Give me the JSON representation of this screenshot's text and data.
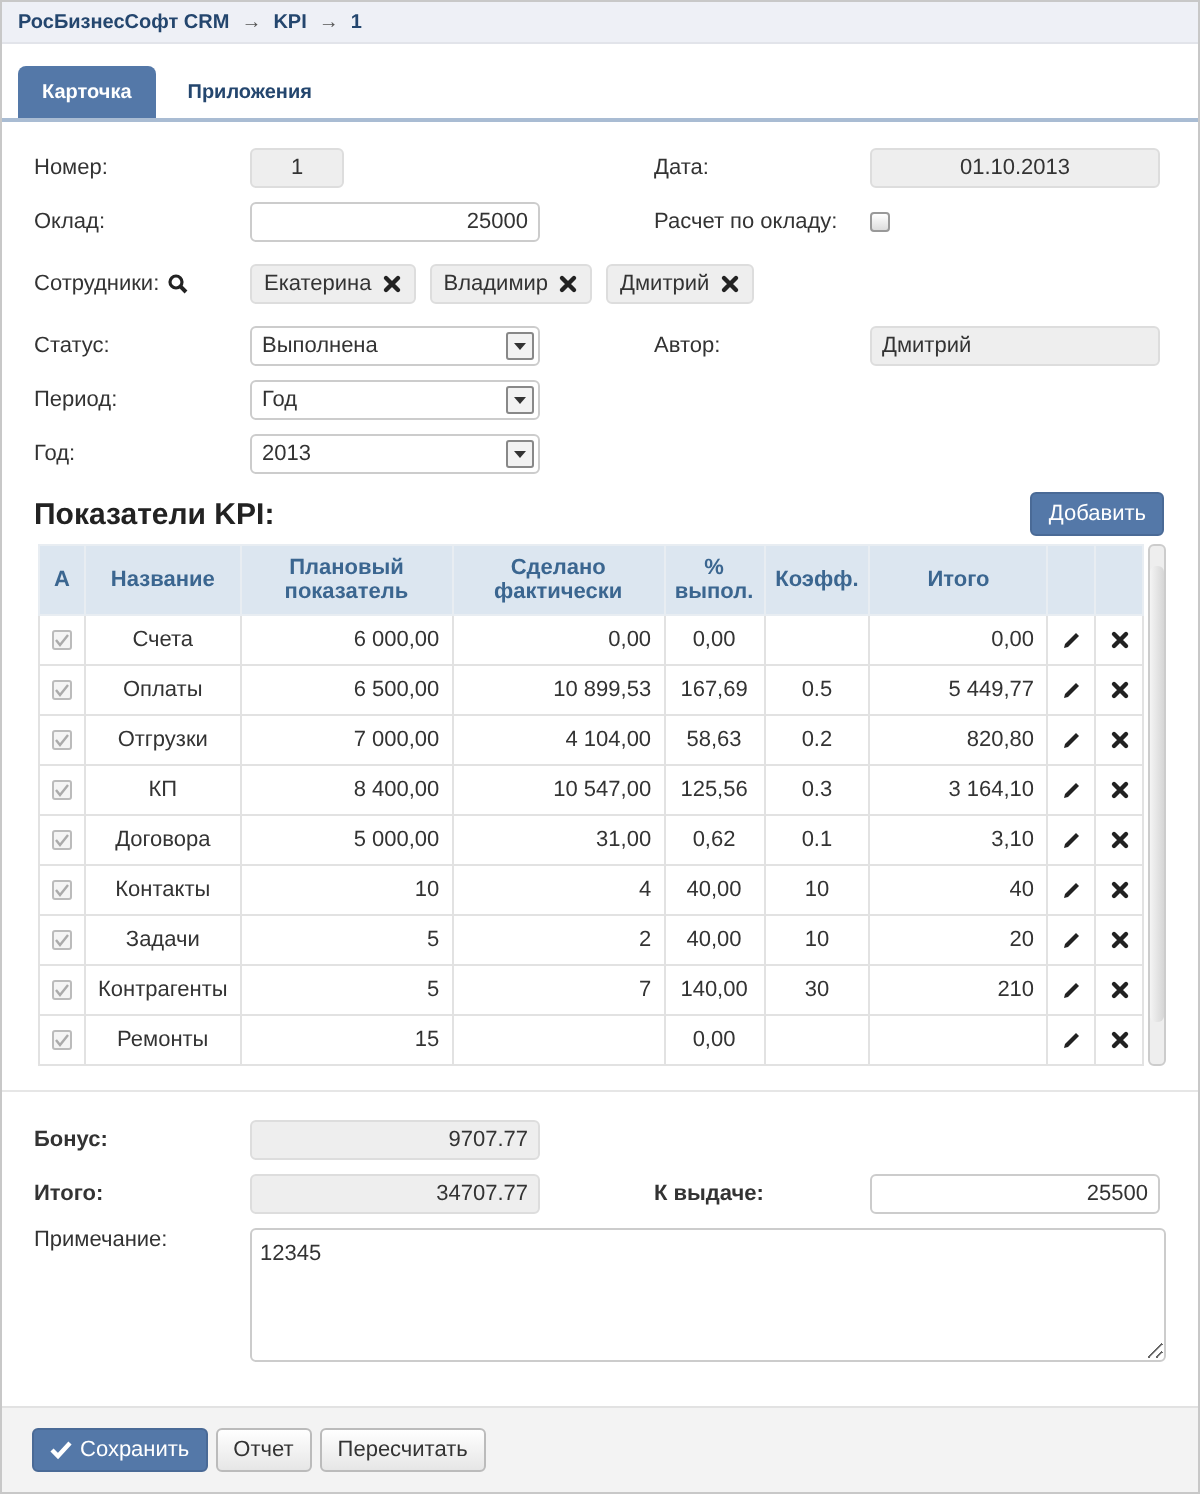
{
  "breadcrumb": {
    "items": [
      "РосБизнесСофт CRM",
      "KPI",
      "1"
    ],
    "separator": "→"
  },
  "tabs": [
    {
      "label": "Карточка",
      "selected": true
    },
    {
      "label": "Приложения",
      "selected": false
    }
  ],
  "form_rows": [
    {
      "left": {
        "label": "Номер:",
        "kind": "readonly_number",
        "value": "1"
      },
      "right": {
        "label": "Дата:",
        "kind": "readonly_date",
        "value": "01.10.2013"
      }
    },
    {
      "left": {
        "label": "Оклад:",
        "kind": "input",
        "value": "25000"
      },
      "right": {
        "label": "Расчет по окладу:",
        "kind": "checkbox",
        "checked": false
      }
    },
    {
      "left": {
        "label": "Сотрудники:",
        "kind": "tags",
        "tags": [
          "Екатерина",
          "Владимир",
          "Дмитрий"
        ]
      }
    },
    {
      "left": {
        "label": "Статус:",
        "kind": "select",
        "value": "Выполнена"
      },
      "right": {
        "label": "Автор:",
        "kind": "readonly_text",
        "value": "Дмитрий"
      }
    },
    {
      "left": {
        "label": "Период:",
        "kind": "select",
        "value": "Год"
      }
    },
    {
      "left": {
        "label": "Год:",
        "kind": "select",
        "value": "2013"
      }
    }
  ],
  "kpi": {
    "title": "Показатели KPI:",
    "add_button": "Добавить",
    "columns": [
      "A",
      "Название",
      "Плановый показатель",
      "Сделано фактически",
      "% выпол.",
      "Коэфф.",
      "Итого"
    ],
    "rows": [
      {
        "checked": true,
        "name": "Счета",
        "plan": "6 000,00",
        "done": "0,00",
        "percent": "0,00",
        "coef": "",
        "total": "0,00"
      },
      {
        "checked": true,
        "name": "Оплаты",
        "plan": "6 500,00",
        "done": "10 899,53",
        "percent": "167,69",
        "coef": "0.5",
        "total": "5 449,77"
      },
      {
        "checked": true,
        "name": "Отгрузки",
        "plan": "7 000,00",
        "done": "4 104,00",
        "percent": "58,63",
        "coef": "0.2",
        "total": "820,80"
      },
      {
        "checked": true,
        "name": "КП",
        "plan": "8 400,00",
        "done": "10 547,00",
        "percent": "125,56",
        "coef": "0.3",
        "total": "3 164,10"
      },
      {
        "checked": true,
        "name": "Договора",
        "plan": "5 000,00",
        "done": "31,00",
        "percent": "0,62",
        "coef": "0.1",
        "total": "3,10"
      },
      {
        "checked": true,
        "name": "Контакты",
        "plan": "10",
        "done": "4",
        "percent": "40,00",
        "coef": "10",
        "total": "40"
      },
      {
        "checked": true,
        "name": "Задачи",
        "plan": "5",
        "done": "2",
        "percent": "40,00",
        "coef": "10",
        "total": "20"
      },
      {
        "checked": true,
        "name": "Контрагенты",
        "plan": "5",
        "done": "7",
        "percent": "140,00",
        "coef": "30",
        "total": "210"
      },
      {
        "checked": true,
        "name": "Ремонты",
        "plan": "15",
        "done": "",
        "percent": "0,00",
        "coef": "",
        "total": ""
      }
    ]
  },
  "totals": {
    "bonus": {
      "label": "Бонус:",
      "value": "9707.77"
    },
    "total": {
      "label": "Итого:",
      "value": "34707.77"
    },
    "payout": {
      "label": "К выдаче:",
      "value": "25500"
    },
    "note": {
      "label": "Примечание:",
      "value": "12345"
    }
  },
  "buttons": [
    {
      "label": "Сохранить",
      "kind": "primary"
    },
    {
      "label": "Отчет",
      "kind": "default"
    },
    {
      "label": "Пересчитать",
      "kind": "default"
    }
  ]
}
